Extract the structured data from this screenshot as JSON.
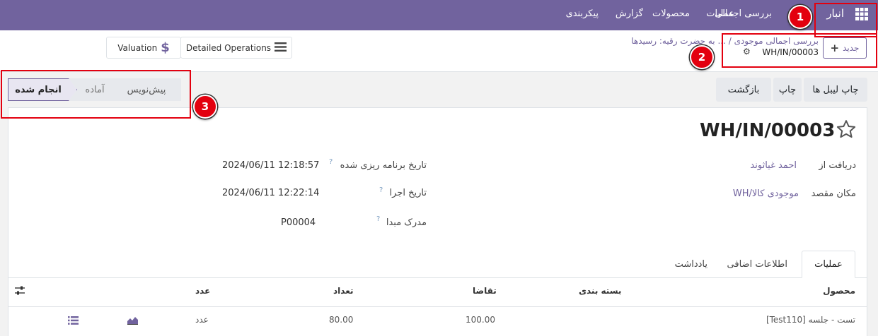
{
  "navbar": {
    "app_name": "انبار",
    "menu": [
      "بررسی اجمالی",
      "عملیات",
      "محصولات",
      "گزارش",
      "پیکربندی"
    ]
  },
  "breadcrumb": {
    "path": "بررسی اجمالی موجودی / ... به حضرت رقیه: رسیدها",
    "current": "WH/IN/00003"
  },
  "toolbar": {
    "new_label": "جدید",
    "detailed_ops_label": "Detailed Operations",
    "valuation_label": "Valuation"
  },
  "actions": {
    "print_labels": "چاپ لیبل ها",
    "print": "چاپ",
    "return": "بازگشت"
  },
  "status": {
    "stages": [
      "پیش‌نویس",
      "آماده",
      "انجام شده"
    ],
    "active": "انجام شده"
  },
  "markers": [
    "1",
    "2",
    "3"
  ],
  "record": {
    "title": "WH/IN/00003",
    "receive_from_label": "دریافت از",
    "receive_from_value": "احمد غیاثوند",
    "dest_label": "مکان مقصد",
    "dest_value": "WH/موجودی کالا",
    "scheduled_label": "تاریخ برنامه ریزی شده",
    "scheduled_value": "2024/06/11 12:18:57",
    "effective_label": "تاریخ اجرا",
    "effective_value": "2024/06/11 12:22:14",
    "origin_label": "مدرک مبدا",
    "origin_value": "P00004"
  },
  "tabs": [
    "عملیات",
    "اطلاعات اضافی",
    "یادداشت"
  ],
  "table": {
    "headers": [
      "محصول",
      "بسته بندی",
      "تقاضا",
      "تعداد",
      "عدد"
    ],
    "row": {
      "product": "[Test110] تست - جلسه",
      "packaging": "",
      "demand": "100.00",
      "quantity": "80.00",
      "uom": "عدد"
    }
  },
  "colors": {
    "brand": "#71639e",
    "annotation_red": "#e3000f"
  },
  "icons": [
    "apps-grid-icon",
    "plus-icon",
    "gear-icon",
    "hamburger-icon",
    "dollar-icon",
    "star-icon",
    "sliders-icon",
    "list-icon",
    "chart-area-icon"
  ]
}
